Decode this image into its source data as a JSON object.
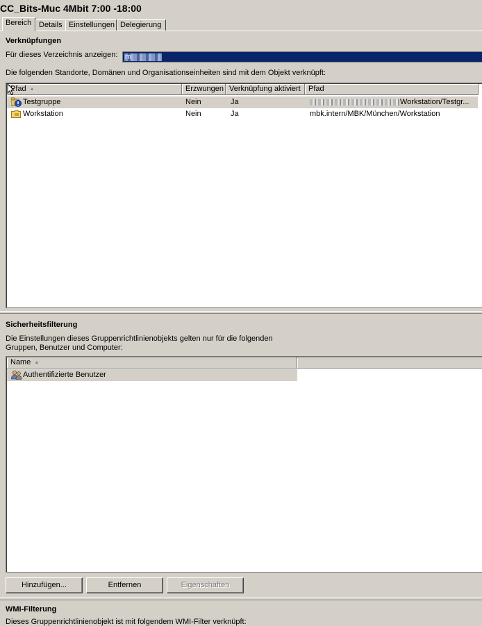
{
  "window": {
    "title": "CC_Bits-Muc 4Mbit 7:00 -18:00"
  },
  "tabs": [
    {
      "label": "Bereich",
      "active": true
    },
    {
      "label": "Details",
      "active": false
    },
    {
      "label": "Einstellungen",
      "active": false
    },
    {
      "label": "Delegierung",
      "active": false
    }
  ],
  "links": {
    "section_title": "Verknüpfungen",
    "dropdown_label": "Für dieses Verzeichnis anzeigen:",
    "dropdown_value": "m",
    "description": "Die folgenden Standorte, Domänen und Organisationseinheiten sind mit dem Objekt verknüpft:",
    "columns": [
      "Pfad",
      "Erzwungen",
      "Verknüpfung aktiviert",
      "Pfad"
    ],
    "rows": [
      {
        "icon": "ou-warning-icon",
        "name": "Testgruppe",
        "enforced": "Nein",
        "enabled": "Ja",
        "path": "Workstation/Testgr...",
        "selected": true
      },
      {
        "icon": "folder-ou-icon",
        "name": "Workstation",
        "enforced": "Nein",
        "enabled": "Ja",
        "path": "mbk.intern/MBK/München/Workstation",
        "selected": false
      }
    ]
  },
  "security": {
    "section_title": "Sicherheitsfilterung",
    "description_line1": "Die Einstellungen dieses Gruppenrichtlinienobjekts gelten nur für die folgenden",
    "description_line2": "Gruppen, Benutzer und Computer:",
    "columns": [
      "Name"
    ],
    "rows": [
      {
        "icon": "users-group-icon",
        "name": "Authentifizierte Benutzer",
        "selected": true
      }
    ],
    "buttons": {
      "add": "Hinzufügen...",
      "remove": "Entfernen",
      "properties": "Eigenschaften"
    }
  },
  "wmi": {
    "section_title": "WMI-Filterung",
    "description": "Dieses Gruppenrichtlinienobjekt ist mit folgendem WMI-Filter verknüpft:"
  },
  "colors": {
    "face": "#d4d0c8",
    "selection": "#0a246a",
    "list_bg": "#ffffff"
  }
}
